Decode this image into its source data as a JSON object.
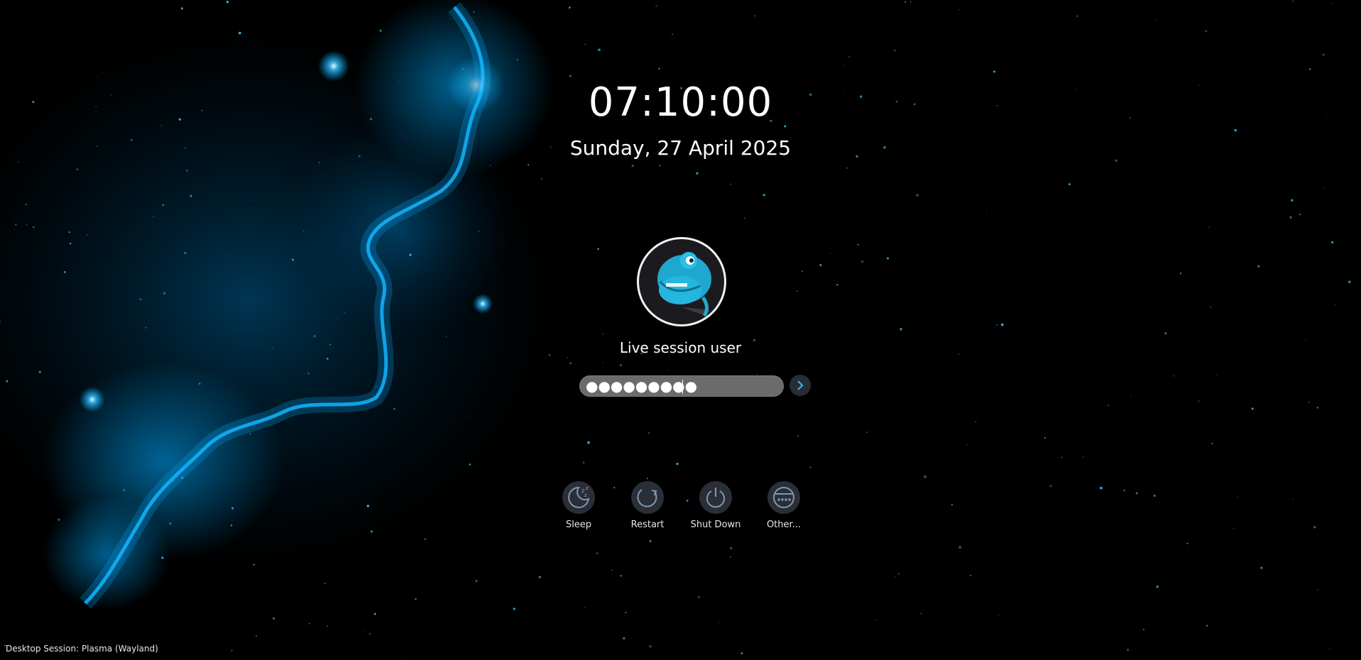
{
  "clock": {
    "time": "07:10:00",
    "date": "Sunday, 27 April 2025"
  },
  "user": {
    "name": "Live session user",
    "avatar_icon": "chameleon-avatar-icon"
  },
  "password": {
    "masked_value": "●●●●●●●●●",
    "submit_icon": "arrow-right-icon"
  },
  "actions": [
    {
      "label": "Sleep",
      "icon": "sleep-icon"
    },
    {
      "label": "Restart",
      "icon": "restart-icon"
    },
    {
      "label": "Shut Down",
      "icon": "power-icon"
    },
    {
      "label": "Other...",
      "icon": "other-icon"
    }
  ],
  "session": {
    "label": "Desktop Session: Plasma (Wayland)"
  },
  "colors": {
    "nebula": "#00aaff",
    "background": "#000000",
    "accent": "#3daee9"
  }
}
